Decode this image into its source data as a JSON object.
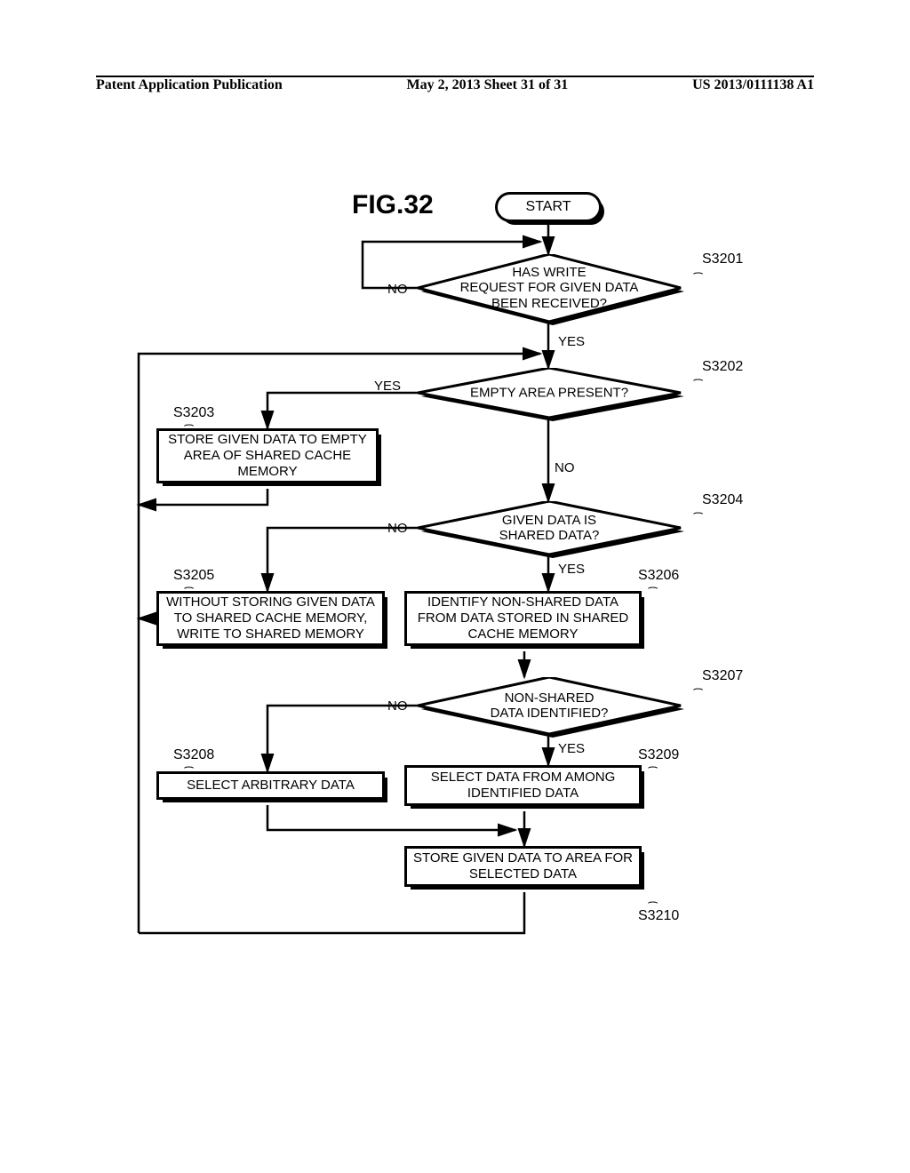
{
  "header": {
    "left": "Patent Application Publication",
    "center": "May 2, 2013  Sheet 31 of 31",
    "right": "US 2013/0111138 A1"
  },
  "figure_label": "FIG.32",
  "nodes": {
    "start": "START",
    "d1": "HAS WRITE\nREQUEST FOR GIVEN DATA\nBEEN RECEIVED?",
    "d2": "EMPTY AREA PRESENT?",
    "p3": "STORE GIVEN DATA TO EMPTY\nAREA OF SHARED CACHE\nMEMORY",
    "d4": "GIVEN DATA IS\nSHARED DATA?",
    "p5": "WITHOUT STORING GIVEN DATA\nTO SHARED CACHE MEMORY,\nWRITE TO SHARED MEMORY",
    "p6": "IDENTIFY NON-SHARED DATA\nFROM DATA STORED IN SHARED\nCACHE MEMORY",
    "d7": "NON-SHARED\nDATA IDENTIFIED?",
    "p8": "SELECT ARBITRARY DATA",
    "p9": "SELECT DATA FROM AMONG\nIDENTIFIED DATA",
    "p10": "STORE GIVEN DATA TO AREA FOR\nSELECTED DATA"
  },
  "stepnums": {
    "s1": "S3201",
    "s2": "S3202",
    "s3": "S3203",
    "s4": "S3204",
    "s5": "S3205",
    "s6": "S3206",
    "s7": "S3207",
    "s8": "S3208",
    "s9": "S3209",
    "s10": "S3210"
  },
  "labels": {
    "yes": "YES",
    "no": "NO"
  },
  "chart_data": {
    "type": "flowchart",
    "title": "FIG.32",
    "nodes": [
      {
        "id": "start",
        "type": "terminal",
        "text": "START"
      },
      {
        "id": "S3201",
        "type": "decision",
        "text": "HAS WRITE REQUEST FOR GIVEN DATA BEEN RECEIVED?"
      },
      {
        "id": "S3202",
        "type": "decision",
        "text": "EMPTY AREA PRESENT?"
      },
      {
        "id": "S3203",
        "type": "process",
        "text": "STORE GIVEN DATA TO EMPTY AREA OF SHARED CACHE MEMORY"
      },
      {
        "id": "S3204",
        "type": "decision",
        "text": "GIVEN DATA IS SHARED DATA?"
      },
      {
        "id": "S3205",
        "type": "process",
        "text": "WITHOUT STORING GIVEN DATA TO SHARED CACHE MEMORY, WRITE TO SHARED MEMORY"
      },
      {
        "id": "S3206",
        "type": "process",
        "text": "IDENTIFY NON-SHARED DATA FROM DATA STORED IN SHARED CACHE MEMORY"
      },
      {
        "id": "S3207",
        "type": "decision",
        "text": "NON-SHARED DATA IDENTIFIED?"
      },
      {
        "id": "S3208",
        "type": "process",
        "text": "SELECT ARBITRARY DATA"
      },
      {
        "id": "S3209",
        "type": "process",
        "text": "SELECT DATA FROM AMONG IDENTIFIED DATA"
      },
      {
        "id": "S3210",
        "type": "process",
        "text": "STORE GIVEN DATA TO AREA FOR SELECTED DATA"
      }
    ],
    "edges": [
      {
        "from": "start",
        "to": "S3201"
      },
      {
        "from": "S3201",
        "to": "S3201",
        "label": "NO",
        "note": "loop back"
      },
      {
        "from": "S3201",
        "to": "S3202",
        "label": "YES"
      },
      {
        "from": "S3202",
        "to": "S3203",
        "label": "YES"
      },
      {
        "from": "S3203",
        "to": "S3201",
        "note": "loop back"
      },
      {
        "from": "S3202",
        "to": "S3204",
        "label": "NO"
      },
      {
        "from": "S3204",
        "to": "S3205",
        "label": "NO"
      },
      {
        "from": "S3205",
        "to": "S3201",
        "note": "loop back"
      },
      {
        "from": "S3204",
        "to": "S3206",
        "label": "YES"
      },
      {
        "from": "S3206",
        "to": "S3207"
      },
      {
        "from": "S3207",
        "to": "S3208",
        "label": "NO"
      },
      {
        "from": "S3208",
        "to": "S3210"
      },
      {
        "from": "S3207",
        "to": "S3209",
        "label": "YES"
      },
      {
        "from": "S3209",
        "to": "S3210"
      },
      {
        "from": "S3210",
        "to": "S3201",
        "note": "loop back"
      }
    ]
  }
}
